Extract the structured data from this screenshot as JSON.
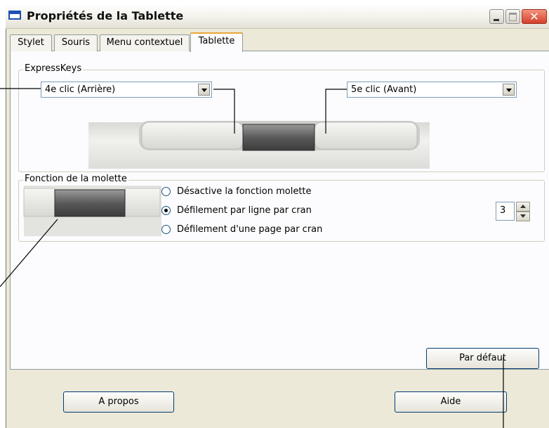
{
  "window": {
    "title": "Propriétés de la Tablette"
  },
  "tabs": [
    {
      "label": "Stylet"
    },
    {
      "label": "Souris"
    },
    {
      "label": "Menu contextuel"
    },
    {
      "label": "Tablette",
      "active": true
    }
  ],
  "expresskeys": {
    "group_label": "ExpressKeys",
    "left_select": "4e clic (Arrière)",
    "right_select": "5e clic (Avant)"
  },
  "molette": {
    "group_label": "Fonction de la molette",
    "options": [
      {
        "label": "Désactive la fonction molette",
        "selected": false
      },
      {
        "label": "Défilement par ligne par cran",
        "selected": true
      },
      {
        "label": "Défilement d'une page par cran",
        "selected": false
      }
    ],
    "lines_value": "3"
  },
  "buttons": {
    "default": "Par défaut",
    "about": "A propos",
    "help": "Aide"
  },
  "colors": {
    "accent_tab": "#e8a73c",
    "close_red": "#d4412b",
    "title_icon": "#1c4fb5"
  }
}
